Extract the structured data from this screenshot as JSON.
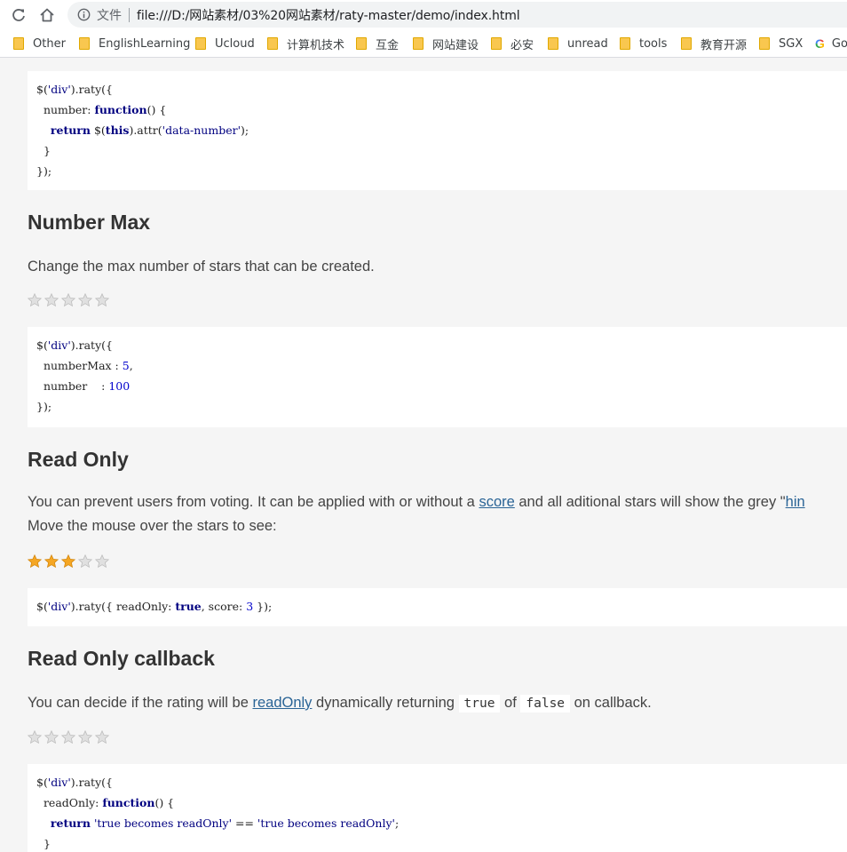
{
  "browser": {
    "scheme_label": "文件",
    "url": "file:///D:/网站素材/03%20网站素材/raty-master/demo/index.html",
    "bookmarks": [
      "Other",
      "EnglishLearning",
      "Ucloud",
      "计算机技术",
      "互金",
      "网站建设",
      "必安",
      "unread",
      "tools",
      "教育开源",
      "SGX",
      "Go"
    ]
  },
  "block_number": {
    "lines": [
      "$('div').raty({",
      "  number: function() {",
      "    return $(this).attr('data-number');",
      "  }",
      "});"
    ]
  },
  "number_max": {
    "title": "Number Max",
    "description": "Change the max number of stars that can be created.",
    "stars": [
      false,
      false,
      false,
      false,
      false
    ],
    "code_lines": [
      "$('div').raty({",
      "  numberMax : 5,",
      "  number    : 100",
      "});"
    ]
  },
  "read_only": {
    "title": "Read Only",
    "desc_part1": "You can prevent users from voting. It can be applied with or without a ",
    "score_link": "score",
    "desc_part2": " and all aditional stars will show the grey \"",
    "hint_link": "hin",
    "desc_line2": "Move the mouse over the stars to see:",
    "stars": [
      true,
      true,
      true,
      false,
      false
    ],
    "code_line": "$('div').raty({ readOnly: true, score: 3 });"
  },
  "read_only_callback": {
    "title": "Read Only callback",
    "desc_part1": "You can decide if the rating will be ",
    "readonly_link": "readOnly",
    "desc_part2": " dynamically returning ",
    "true_code": "true",
    "of_text": " of ",
    "false_code": "false",
    "desc_part3": " on callback.",
    "stars": [
      false,
      false,
      false,
      false,
      false
    ],
    "code_lines": [
      "$('div').raty({",
      "  readOnly: function() {",
      "    return 'true becomes readOnly' == 'true becomes readOnly';",
      "  }"
    ]
  },
  "colors": {
    "star_on": "#f5a623",
    "star_off": "#e0e0e0",
    "link": "#2a6496"
  }
}
